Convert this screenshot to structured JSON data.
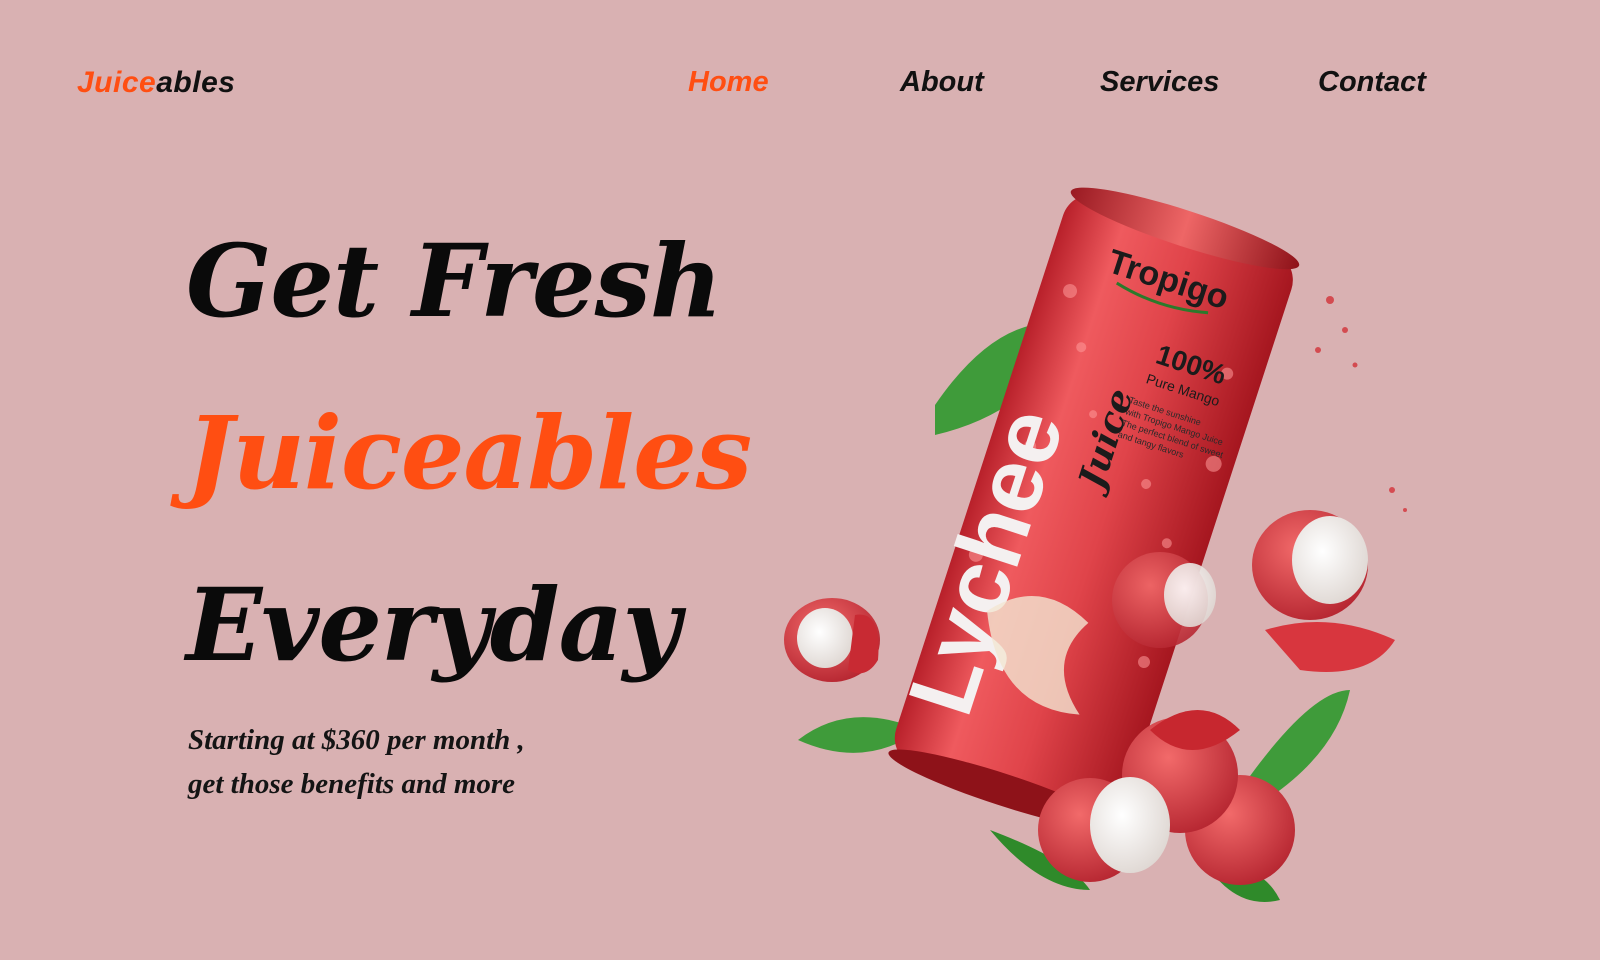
{
  "brand": {
    "part1": "Juice",
    "part2": "ables"
  },
  "nav": [
    {
      "label": "Home",
      "active": true
    },
    {
      "label": "About",
      "active": false
    },
    {
      "label": "Services",
      "active": false
    },
    {
      "label": "Contact",
      "active": false
    }
  ],
  "hero": {
    "line1": "Get Fresh",
    "line2": "Juiceables",
    "line3": "Everyday",
    "sub1": "Starting at $360 per month ,",
    "sub2": "get those benefits and more"
  },
  "can": {
    "brand": "Tropigo",
    "percent": "100%",
    "flavor": "Pure Mango",
    "name": "Lychee",
    "juice": "Juice",
    "desc": [
      "Taste the sunshine",
      "with Tropigo Mango Juice",
      "The perfect blend of sweet",
      "and tangy flavors"
    ]
  },
  "colors": {
    "background": "#d9b1b2",
    "accent": "#ff4e12",
    "text": "#111111",
    "can": "#e0444a"
  }
}
